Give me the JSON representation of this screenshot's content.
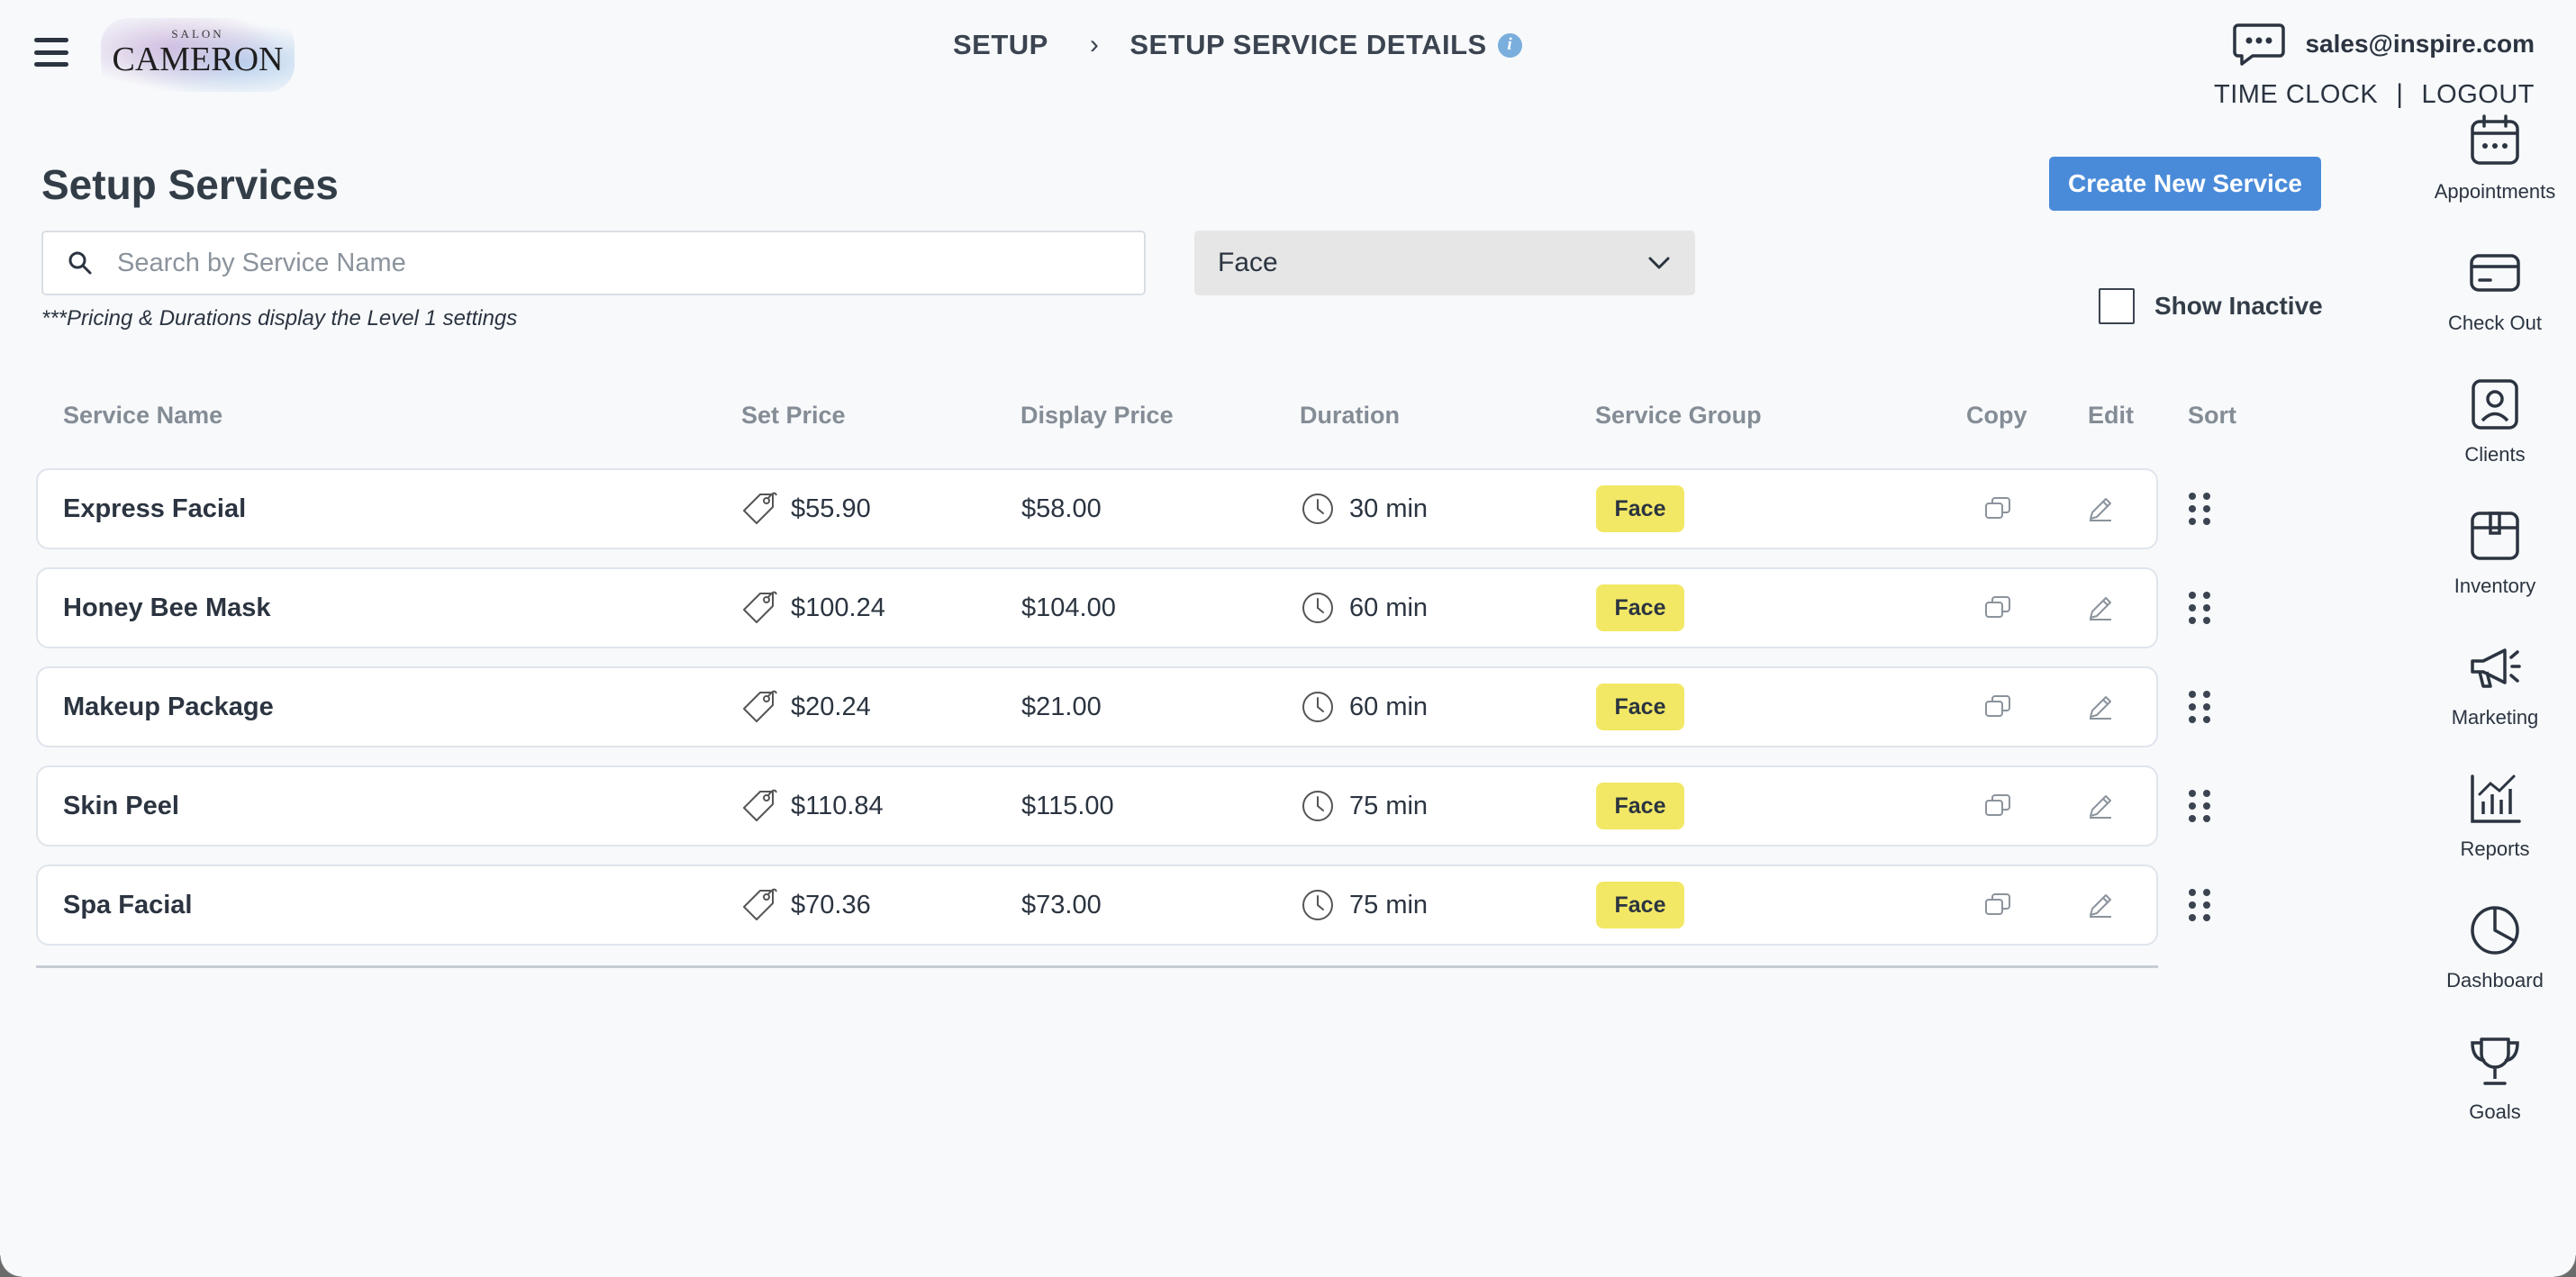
{
  "header": {
    "logo": {
      "small": "SALON",
      "big": "CAMERON"
    },
    "breadcrumb": {
      "parent": "SETUP",
      "separator": "›",
      "current": "SETUP SERVICE DETAILS",
      "info": "i"
    },
    "email": "sales@inspire.com",
    "time_clock": "TIME CLOCK",
    "divider": "|",
    "logout": "LOGOUT"
  },
  "sidebar": {
    "items": [
      {
        "label": "Appointments",
        "icon": "calendar-icon"
      },
      {
        "label": "Check Out",
        "icon": "credit-card-icon"
      },
      {
        "label": "Clients",
        "icon": "client-icon"
      },
      {
        "label": "Inventory",
        "icon": "box-icon"
      },
      {
        "label": "Marketing",
        "icon": "megaphone-icon"
      },
      {
        "label": "Reports",
        "icon": "bar-chart-icon"
      },
      {
        "label": "Dashboard",
        "icon": "pie-chart-icon"
      },
      {
        "label": "Goals",
        "icon": "trophy-icon"
      }
    ]
  },
  "main": {
    "title": "Setup Services",
    "create_button": "Create New Service",
    "search": {
      "placeholder": "Search by Service Name",
      "value": ""
    },
    "group_select": {
      "value": "Face"
    },
    "note": "***Pricing & Durations display the Level 1 settings",
    "show_inactive": {
      "label": "Show Inactive",
      "checked": false
    }
  },
  "table": {
    "columns": [
      "Service Name",
      "Set Price",
      "Display Price",
      "Duration",
      "Service Group",
      "Copy",
      "Edit",
      "Sort"
    ],
    "rows": [
      {
        "name": "Express Facial",
        "set_price": "$55.90",
        "display_price": "$58.00",
        "duration": "30 min",
        "group": "Face"
      },
      {
        "name": "Honey Bee Mask",
        "set_price": "$100.24",
        "display_price": "$104.00",
        "duration": "60 min",
        "group": "Face"
      },
      {
        "name": "Makeup Package",
        "set_price": "$20.24",
        "display_price": "$21.00",
        "duration": "60 min",
        "group": "Face"
      },
      {
        "name": "Skin Peel",
        "set_price": "$110.84",
        "display_price": "$115.00",
        "duration": "75 min",
        "group": "Face"
      },
      {
        "name": "Spa Facial",
        "set_price": "$70.36",
        "display_price": "$73.00",
        "duration": "75 min",
        "group": "Face"
      }
    ]
  },
  "colors": {
    "accent": "#4a8bd9",
    "badge": "#f2e865",
    "text": "#2b3440",
    "header_muted": "#848c95"
  }
}
